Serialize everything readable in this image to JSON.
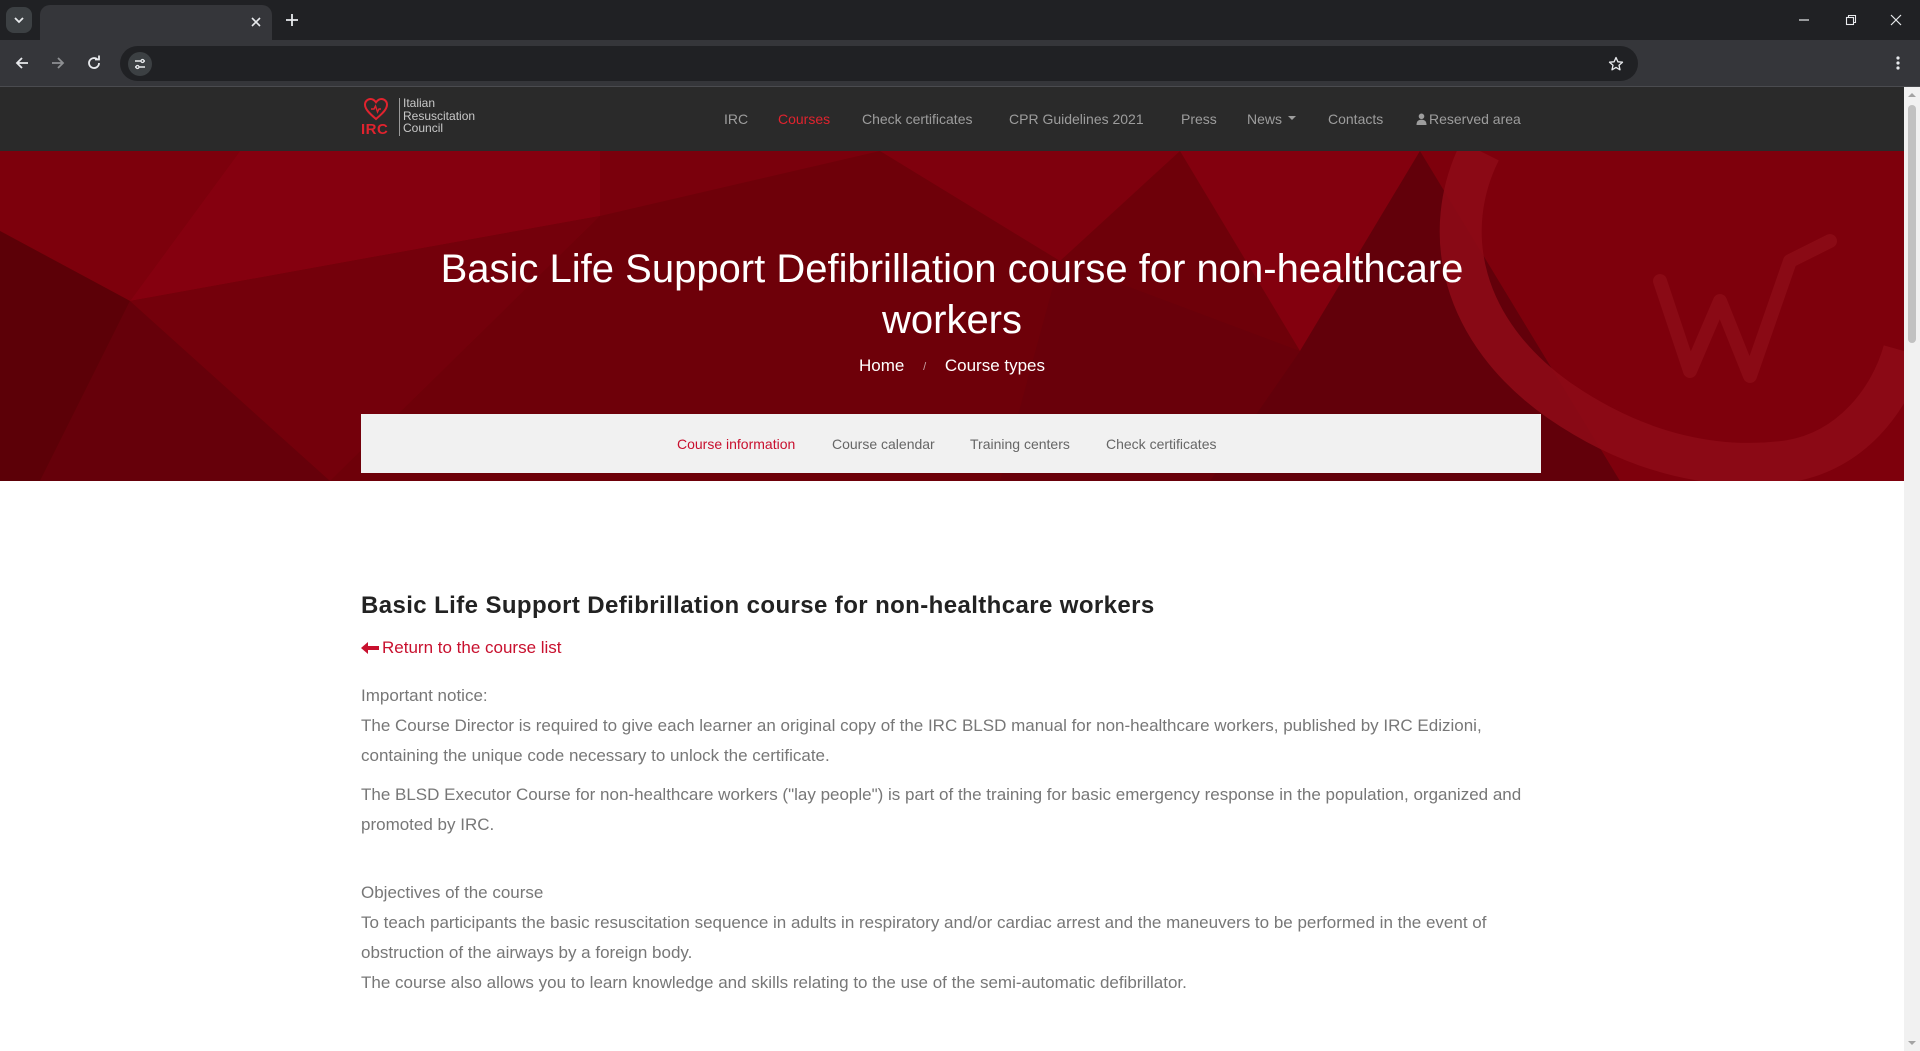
{
  "browser": {
    "tab_title": "",
    "address": ""
  },
  "site": {
    "logo": {
      "abbr": "IRC",
      "line1": "Italian",
      "line2": "Resuscitation",
      "line3": "Council"
    },
    "nav": [
      {
        "label": "IRC"
      },
      {
        "label": "Courses",
        "active": true
      },
      {
        "label": "Check certificates"
      },
      {
        "label": "CPR Guidelines 2021"
      },
      {
        "label": "Press"
      },
      {
        "label": "News"
      },
      {
        "label": "Contacts"
      },
      {
        "label": "Reserved area"
      }
    ]
  },
  "hero": {
    "title": "Basic Life Support Defibrillation course for non-healthcare workers",
    "breadcrumb": [
      "Home",
      "/",
      "Course types"
    ]
  },
  "subtabs": [
    {
      "label": "Course information",
      "active": true
    },
    {
      "label": "Course calendar"
    },
    {
      "label": "Training centers"
    },
    {
      "label": "Check certificates"
    }
  ],
  "content": {
    "title": "Basic Life Support Defibrillation course for non-healthcare workers",
    "return_link": "Return to the course list",
    "notice_heading": "Important notice:",
    "notice_text": "The Course Director is required to give each learner an original copy of the IRC BLSD manual for non-healthcare workers, published by IRC Edizioni, containing the unique code necessary to unlock the certificate.",
    "intro_text": "The BLSD Executor Course for non-healthcare workers (\"lay people\") is part of the training for basic emergency response in the population, organized and promoted by IRC.",
    "objectives_heading": "Objectives of the course",
    "objectives_text": "To teach participants the basic resuscitation sequence in adults in respiratory and/or cardiac arrest and the maneuvers to be performed in the event of obstruction of the airways by a foreign body.",
    "objectives_text2": "The course also allows you to learn knowledge and skills relating to the use of the semi-automatic defibrillator."
  },
  "colors": {
    "accent": "#e0232e",
    "hero_bg": "#6e0009",
    "nav_bg": "#2a2a2a"
  }
}
